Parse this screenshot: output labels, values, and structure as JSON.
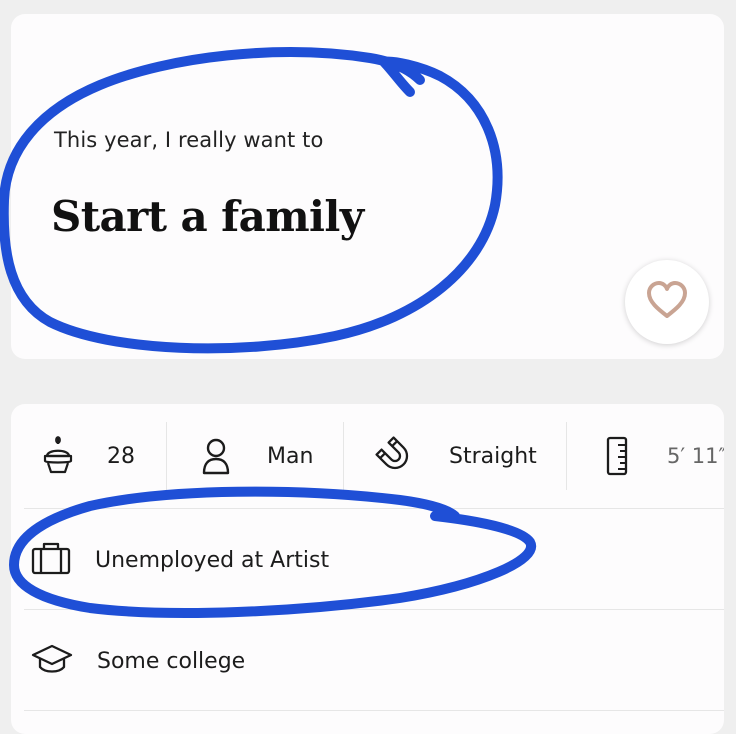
{
  "prompt": {
    "question": "This year, I really want to",
    "answer": "Start a family"
  },
  "like_button": {
    "icon": "heart-icon",
    "color": "#c9a493"
  },
  "stats": [
    {
      "icon": "birthday-cake-icon",
      "value": "28"
    },
    {
      "icon": "person-icon",
      "value": "Man"
    },
    {
      "icon": "magnet-icon",
      "value": "Straight"
    },
    {
      "icon": "ruler-icon",
      "value": "5′ 11″"
    }
  ],
  "job": {
    "icon": "briefcase-icon",
    "text": "Unemployed at Artist"
  },
  "education": {
    "icon": "graduation-cap-icon",
    "text": "Some college"
  },
  "annotation": {
    "color": "#1f4fd6"
  }
}
